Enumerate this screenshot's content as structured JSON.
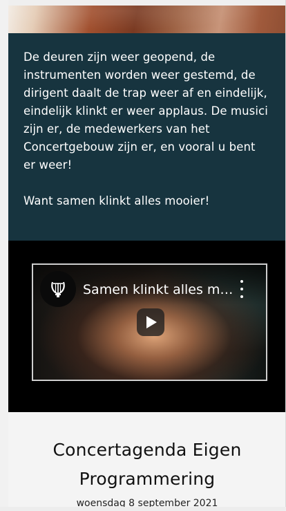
{
  "article": {
    "paragraph_1": "De deuren zijn weer geopend, de instrumenten worden weer gestemd, de dirigent daalt de trap weer af en eindelijk, eindelijk klinkt er weer applaus. De musici zijn er, de medewerkers van het Concertgebouw zijn er, en vooral u bent er weer!",
    "paragraph_2": "Want samen klinkt alles mooier!"
  },
  "video": {
    "title": "Samen klinkt alles mooier!",
    "channel_logo_icon": "lyre-icon",
    "menu_icon": "more-vert-icon",
    "play_icon": "play-icon"
  },
  "agenda": {
    "title": "Concertagenda Eigen Programmering",
    "date": "woensdag 8 september 2021"
  },
  "colors": {
    "teal_background": "#17343f",
    "video_background": "#000000",
    "page_background": "#f4f4f4"
  }
}
